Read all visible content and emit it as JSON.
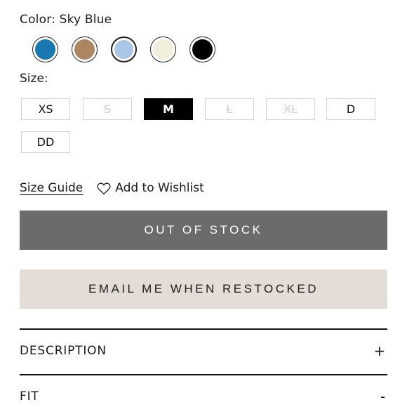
{
  "color": {
    "label": "Color: Sky Blue",
    "swatches": [
      {
        "name": "Blue",
        "hex": "#1a78b0"
      },
      {
        "name": "Tan",
        "hex": "#ad8560"
      },
      {
        "name": "Sky Blue",
        "hex": "#aac6e6"
      },
      {
        "name": "Cream",
        "hex": "#f1eedc"
      },
      {
        "name": "Black",
        "hex": "#000000"
      }
    ]
  },
  "size": {
    "label": "Size:",
    "options": [
      {
        "label": "XS",
        "state": "available"
      },
      {
        "label": "S",
        "state": "unavailable"
      },
      {
        "label": "M",
        "state": "selected"
      },
      {
        "label": "L",
        "state": "unavailable"
      },
      {
        "label": "XL",
        "state": "unavailable"
      },
      {
        "label": "D",
        "state": "available"
      },
      {
        "label": "DD",
        "state": "available"
      }
    ]
  },
  "links": {
    "size_guide": "Size Guide",
    "wishlist": "Add to Wishlist",
    "wishlist_icon": "heart-icon"
  },
  "buttons": {
    "out_of_stock": "OUT OF STOCK",
    "email_restock": "EMAIL ME WHEN RESTOCKED",
    "out_of_stock_color": "#6b6b6b",
    "email_restock_color": "#e4dcd7"
  },
  "accordion": [
    {
      "label": "DESCRIPTION",
      "sign": "+"
    },
    {
      "label": "FIT",
      "sign": "-"
    }
  ]
}
